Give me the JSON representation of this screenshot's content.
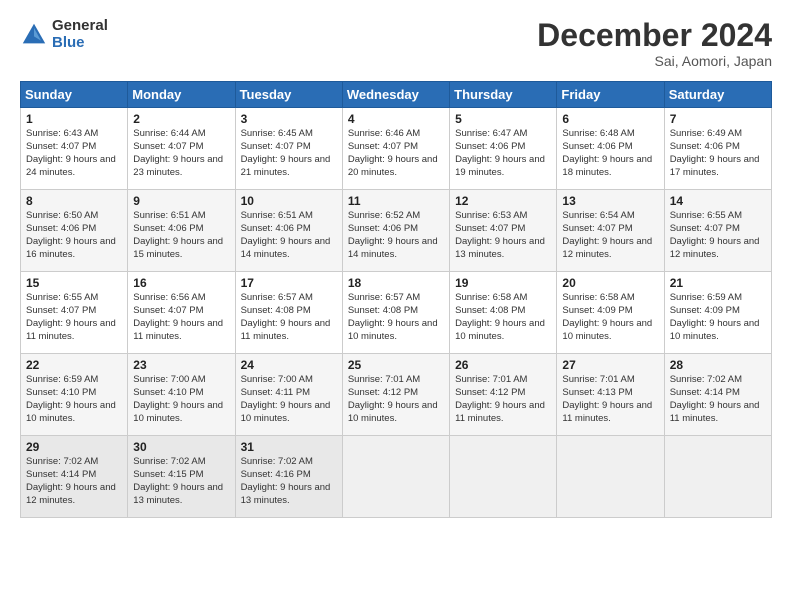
{
  "header": {
    "logo_general": "General",
    "logo_blue": "Blue",
    "month_title": "December 2024",
    "subtitle": "Sai, Aomori, Japan"
  },
  "weekdays": [
    "Sunday",
    "Monday",
    "Tuesday",
    "Wednesday",
    "Thursday",
    "Friday",
    "Saturday"
  ],
  "weeks": [
    [
      {
        "day": "1",
        "sunrise": "Sunrise: 6:43 AM",
        "sunset": "Sunset: 4:07 PM",
        "daylight": "Daylight: 9 hours and 24 minutes."
      },
      {
        "day": "2",
        "sunrise": "Sunrise: 6:44 AM",
        "sunset": "Sunset: 4:07 PM",
        "daylight": "Daylight: 9 hours and 23 minutes."
      },
      {
        "day": "3",
        "sunrise": "Sunrise: 6:45 AM",
        "sunset": "Sunset: 4:07 PM",
        "daylight": "Daylight: 9 hours and 21 minutes."
      },
      {
        "day": "4",
        "sunrise": "Sunrise: 6:46 AM",
        "sunset": "Sunset: 4:07 PM",
        "daylight": "Daylight: 9 hours and 20 minutes."
      },
      {
        "day": "5",
        "sunrise": "Sunrise: 6:47 AM",
        "sunset": "Sunset: 4:06 PM",
        "daylight": "Daylight: 9 hours and 19 minutes."
      },
      {
        "day": "6",
        "sunrise": "Sunrise: 6:48 AM",
        "sunset": "Sunset: 4:06 PM",
        "daylight": "Daylight: 9 hours and 18 minutes."
      },
      {
        "day": "7",
        "sunrise": "Sunrise: 6:49 AM",
        "sunset": "Sunset: 4:06 PM",
        "daylight": "Daylight: 9 hours and 17 minutes."
      }
    ],
    [
      {
        "day": "8",
        "sunrise": "Sunrise: 6:50 AM",
        "sunset": "Sunset: 4:06 PM",
        "daylight": "Daylight: 9 hours and 16 minutes."
      },
      {
        "day": "9",
        "sunrise": "Sunrise: 6:51 AM",
        "sunset": "Sunset: 4:06 PM",
        "daylight": "Daylight: 9 hours and 15 minutes."
      },
      {
        "day": "10",
        "sunrise": "Sunrise: 6:51 AM",
        "sunset": "Sunset: 4:06 PM",
        "daylight": "Daylight: 9 hours and 14 minutes."
      },
      {
        "day": "11",
        "sunrise": "Sunrise: 6:52 AM",
        "sunset": "Sunset: 4:06 PM",
        "daylight": "Daylight: 9 hours and 14 minutes."
      },
      {
        "day": "12",
        "sunrise": "Sunrise: 6:53 AM",
        "sunset": "Sunset: 4:07 PM",
        "daylight": "Daylight: 9 hours and 13 minutes."
      },
      {
        "day": "13",
        "sunrise": "Sunrise: 6:54 AM",
        "sunset": "Sunset: 4:07 PM",
        "daylight": "Daylight: 9 hours and 12 minutes."
      },
      {
        "day": "14",
        "sunrise": "Sunrise: 6:55 AM",
        "sunset": "Sunset: 4:07 PM",
        "daylight": "Daylight: 9 hours and 12 minutes."
      }
    ],
    [
      {
        "day": "15",
        "sunrise": "Sunrise: 6:55 AM",
        "sunset": "Sunset: 4:07 PM",
        "daylight": "Daylight: 9 hours and 11 minutes."
      },
      {
        "day": "16",
        "sunrise": "Sunrise: 6:56 AM",
        "sunset": "Sunset: 4:07 PM",
        "daylight": "Daylight: 9 hours and 11 minutes."
      },
      {
        "day": "17",
        "sunrise": "Sunrise: 6:57 AM",
        "sunset": "Sunset: 4:08 PM",
        "daylight": "Daylight: 9 hours and 11 minutes."
      },
      {
        "day": "18",
        "sunrise": "Sunrise: 6:57 AM",
        "sunset": "Sunset: 4:08 PM",
        "daylight": "Daylight: 9 hours and 10 minutes."
      },
      {
        "day": "19",
        "sunrise": "Sunrise: 6:58 AM",
        "sunset": "Sunset: 4:08 PM",
        "daylight": "Daylight: 9 hours and 10 minutes."
      },
      {
        "day": "20",
        "sunrise": "Sunrise: 6:58 AM",
        "sunset": "Sunset: 4:09 PM",
        "daylight": "Daylight: 9 hours and 10 minutes."
      },
      {
        "day": "21",
        "sunrise": "Sunrise: 6:59 AM",
        "sunset": "Sunset: 4:09 PM",
        "daylight": "Daylight: 9 hours and 10 minutes."
      }
    ],
    [
      {
        "day": "22",
        "sunrise": "Sunrise: 6:59 AM",
        "sunset": "Sunset: 4:10 PM",
        "daylight": "Daylight: 9 hours and 10 minutes."
      },
      {
        "day": "23",
        "sunrise": "Sunrise: 7:00 AM",
        "sunset": "Sunset: 4:10 PM",
        "daylight": "Daylight: 9 hours and 10 minutes."
      },
      {
        "day": "24",
        "sunrise": "Sunrise: 7:00 AM",
        "sunset": "Sunset: 4:11 PM",
        "daylight": "Daylight: 9 hours and 10 minutes."
      },
      {
        "day": "25",
        "sunrise": "Sunrise: 7:01 AM",
        "sunset": "Sunset: 4:12 PM",
        "daylight": "Daylight: 9 hours and 10 minutes."
      },
      {
        "day": "26",
        "sunrise": "Sunrise: 7:01 AM",
        "sunset": "Sunset: 4:12 PM",
        "daylight": "Daylight: 9 hours and 11 minutes."
      },
      {
        "day": "27",
        "sunrise": "Sunrise: 7:01 AM",
        "sunset": "Sunset: 4:13 PM",
        "daylight": "Daylight: 9 hours and 11 minutes."
      },
      {
        "day": "28",
        "sunrise": "Sunrise: 7:02 AM",
        "sunset": "Sunset: 4:14 PM",
        "daylight": "Daylight: 9 hours and 11 minutes."
      }
    ],
    [
      {
        "day": "29",
        "sunrise": "Sunrise: 7:02 AM",
        "sunset": "Sunset: 4:14 PM",
        "daylight": "Daylight: 9 hours and 12 minutes."
      },
      {
        "day": "30",
        "sunrise": "Sunrise: 7:02 AM",
        "sunset": "Sunset: 4:15 PM",
        "daylight": "Daylight: 9 hours and 13 minutes."
      },
      {
        "day": "31",
        "sunrise": "Sunrise: 7:02 AM",
        "sunset": "Sunset: 4:16 PM",
        "daylight": "Daylight: 9 hours and 13 minutes."
      },
      null,
      null,
      null,
      null
    ]
  ]
}
